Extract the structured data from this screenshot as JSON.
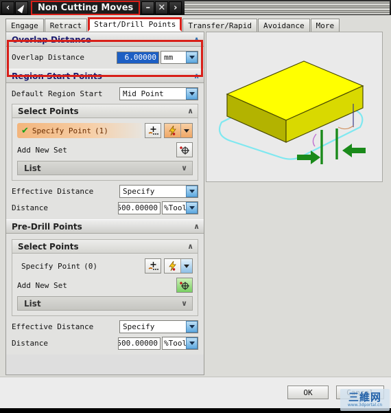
{
  "window": {
    "title": "Non Cutting Moves",
    "back_icon": "chevron-left-icon",
    "cursor_icon": "cursor-arrow-icon",
    "minimize_label": "–",
    "close_label": "✕",
    "forward_label": "›"
  },
  "tabs": [
    {
      "label": "Engage",
      "active": false
    },
    {
      "label": "Retract",
      "active": false
    },
    {
      "label": "Start/Drill Points",
      "active": true
    },
    {
      "label": "Transfer/Rapid",
      "active": false
    },
    {
      "label": "Avoidance",
      "active": false
    },
    {
      "label": "More",
      "active": false
    }
  ],
  "overlap_group": {
    "title": "Overlap Distance",
    "collapse_chevron": "∧",
    "field_label": "Overlap Distance",
    "value": "6.00000",
    "unit": "mm"
  },
  "region_group": {
    "title": "Region Start Points",
    "collapse_chevron": "∧",
    "default_start_label": "Default Region Start",
    "default_start_value": "Mid Point",
    "select_points": {
      "title": "Select Points",
      "collapse_chevron": "∧",
      "specify_point_label": "Specify Point",
      "specify_point_count": "(1)",
      "checkmark": "✔",
      "point_constructor_icon": "point-constructor-icon",
      "snap_icon": "snap-point-icon",
      "dropdown_icon": "chevron-down-icon",
      "add_new_set_label": "Add New Set",
      "add_new_set_icon": "add-new-set-icon",
      "list_label": "List",
      "list_chevron": "∨"
    },
    "effective_distance_label": "Effective Distance",
    "effective_distance_value": "Specify",
    "distance_label": "Distance",
    "distance_value": "500.00000",
    "distance_unit": "%Tool"
  },
  "predrill_group": {
    "title": "Pre-Drill Points",
    "collapse_chevron": "∧",
    "select_points": {
      "title": "Select Points",
      "collapse_chevron": "∧",
      "specify_point_label": "Specify Point",
      "specify_point_count": "(0)",
      "point_constructor_icon": "point-constructor-icon",
      "snap_icon": "snap-point-icon",
      "dropdown_icon": "chevron-down-icon",
      "add_new_set_label": "Add New Set",
      "add_new_set_icon": "add-new-set-icon",
      "list_label": "List",
      "list_chevron": "∨"
    },
    "effective_distance_label": "Effective Distance",
    "effective_distance_value": "Specify",
    "distance_label": "Distance",
    "distance_value": "500.00000",
    "distance_unit": "%Tool"
  },
  "preview": {
    "name": "toolpath-3d-preview",
    "block_top_color": "#ffff00",
    "block_side_color": "#b3b300",
    "toolpath_color": "#7fe8f0",
    "arrow_color": "#1a8a1a",
    "line_color": "#1a8a1a"
  },
  "footer": {
    "ok_label": "OK",
    "cancel_label": "Cancel"
  },
  "watermark": {
    "text_cn": "三維网",
    "text_url": "www.3dportal.cn"
  }
}
